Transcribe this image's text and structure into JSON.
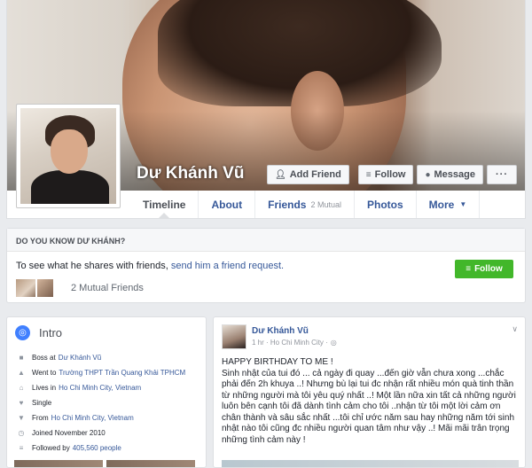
{
  "profile": {
    "name": "Dư Khánh Vũ"
  },
  "actions": {
    "add_friend": "Add Friend",
    "follow": "Follow",
    "message": "Message",
    "more": "···"
  },
  "tabs": [
    {
      "label": "Timeline"
    },
    {
      "label": "About"
    },
    {
      "label": "Friends",
      "count": "2 Mutual"
    },
    {
      "label": "Photos"
    },
    {
      "label": "More"
    }
  ],
  "know": {
    "heading": "DO YOU KNOW DƯ KHÁNH?",
    "text": "To see what he shares with friends,",
    "link": "send him a friend request.",
    "follow_button": "Follow",
    "mutual": "2 Mutual Friends"
  },
  "intro": {
    "title": "Intro",
    "items": [
      {
        "icon": "briefcase-icon",
        "text": "Boss at",
        "link": "Dư Khánh Vũ"
      },
      {
        "icon": "school-icon",
        "text": "Went to",
        "link": "Trường THPT Trần Quang Khải TPHCM"
      },
      {
        "icon": "home-icon",
        "text": "Lives in",
        "link": "Ho Chi Minh City, Vietnam"
      },
      {
        "icon": "heart-icon",
        "text": "Single",
        "link": ""
      },
      {
        "icon": "pin-icon",
        "text": "From",
        "link": "Ho Chi Minh City, Vietnam"
      },
      {
        "icon": "clock-icon",
        "text": "Joined November 2010",
        "link": ""
      },
      {
        "icon": "rss-icon",
        "text": "Followed by",
        "link": "405,560 people"
      }
    ]
  },
  "post": {
    "author": "Dư Khánh Vũ",
    "meta": "1 hr · Ho Chi Minh City ·",
    "body": "HAPPY BIRTHDAY TO ME !\nSinh nhật của tui đó ... cả ngày đi quay ...đến giờ vẫn chưa xong ...chắc phải đến 2h khuya ..! Nhưng bù lại tui đc nhận rất nhiều món quà tinh thần từ những người mà tôi yêu quý nhất ..! Một lần nữa xin tất cả những người luôn bên cạnh tôi đã dành tình cảm cho tôi ..nhận từ tôi một lời cảm ơn chân thành và sâu sắc nhất ...tôi chỉ ước năm sau hay những năm tới sinh nhật nào tôi cũng đc nhiều người quan tâm như vậy ..! Mãi mãi trân trọng những tình cảm này !"
  }
}
